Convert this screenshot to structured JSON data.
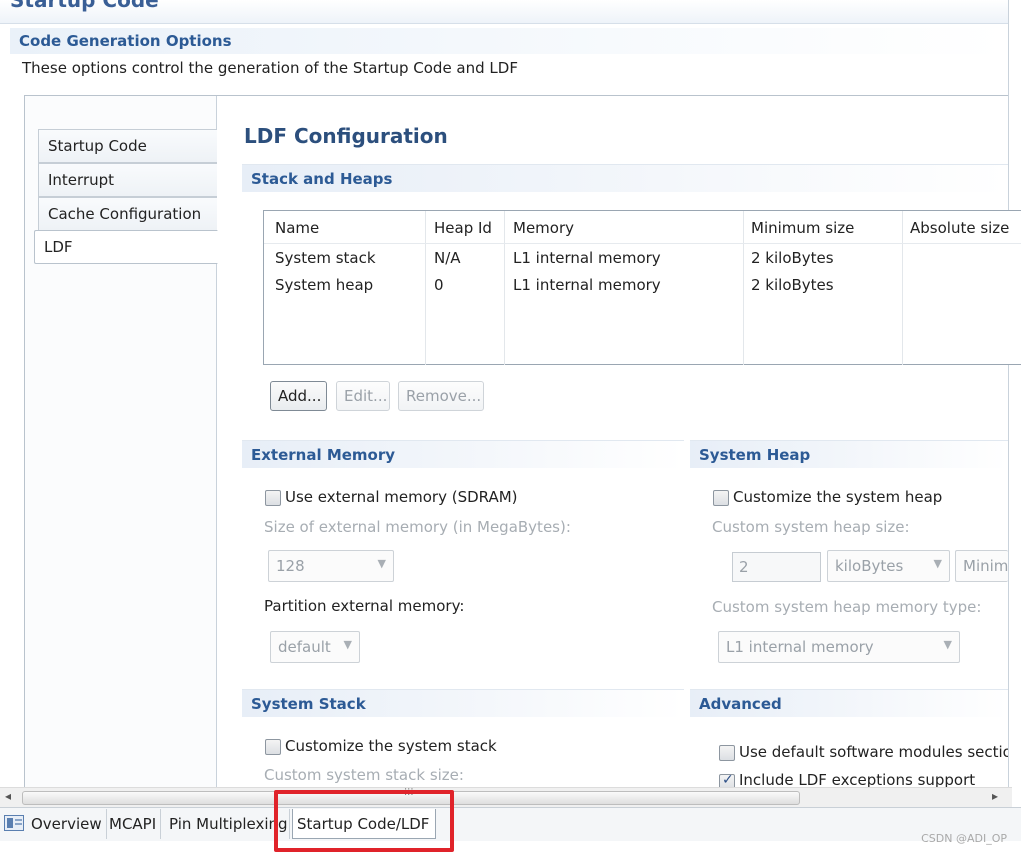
{
  "header": {
    "cut_title": "Startup Code",
    "section_title": "Code Generation Options",
    "section_desc": "These options control the generation of the Startup Code and LDF"
  },
  "side_tabs": [
    {
      "label": "Startup Code"
    },
    {
      "label": "Interrupt"
    },
    {
      "label": "Cache Configuration"
    },
    {
      "label": "LDF"
    }
  ],
  "ldf": {
    "title": "LDF Configuration",
    "stack_heaps": {
      "title": "Stack and Heaps",
      "columns": [
        "Name",
        "Heap Id",
        "Memory",
        "Minimum size",
        "Absolute size"
      ],
      "rows": [
        [
          "System stack",
          "N/A",
          "L1 internal memory",
          "2 kiloBytes",
          ""
        ],
        [
          "System heap",
          "0",
          "L1 internal memory",
          "2 kiloBytes",
          ""
        ]
      ],
      "buttons": {
        "add": "Add...",
        "edit": "Edit...",
        "remove": "Remove..."
      }
    },
    "external_memory": {
      "title": "External Memory",
      "use_label": "Use external memory (SDRAM)",
      "size_label": "Size of external memory (in MegaBytes):",
      "size_value": "128",
      "partition_label": "Partition external memory:",
      "partition_value": "default"
    },
    "system_heap": {
      "title": "System Heap",
      "customize_label": "Customize the system heap",
      "size_label": "Custom system heap size:",
      "size_value": "2",
      "unit_value": "kiloBytes",
      "min_value": "Minim",
      "type_label": "Custom system heap memory type:",
      "type_value": "L1 internal memory"
    },
    "system_stack": {
      "title": "System Stack",
      "customize_label": "Customize the system stack",
      "size_label": "Custom system stack size:"
    },
    "advanced": {
      "title": "Advanced",
      "modules_label": "Use default software modules sectio",
      "exceptions_label": "Include LDF exceptions support",
      "exceptions_checked": true
    }
  },
  "bottom_tabs": [
    {
      "label": "Overview"
    },
    {
      "label": "MCAPI"
    },
    {
      "label": "Pin Multiplexing"
    },
    {
      "label": "Startup Code/LDF"
    }
  ],
  "watermark": "CSDN @ADI_OP",
  "colors": {
    "accent": "#2c5a95",
    "highlight": "#e0232a"
  }
}
